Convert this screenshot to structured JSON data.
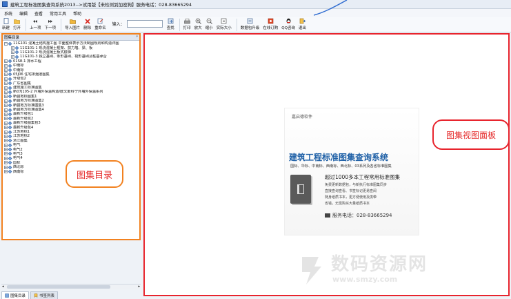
{
  "window": {
    "title": "建筑工程标准图集查询系统2013-->试用版【未检测到加密狗】服务电话：028-83665294"
  },
  "menu": [
    "系统",
    "编辑",
    "查看",
    "常用工具",
    "帮助"
  ],
  "toolbar": {
    "new": "新建",
    "open": "打开",
    "prev": "上一项",
    "next": "下一项",
    "import": "导入图片",
    "delete": "删除",
    "rename": "重命名",
    "input_label": "输入：",
    "input_value": "",
    "find": "查找",
    "print": "打印",
    "zoom_in": "放大",
    "zoom_out": "缩小",
    "actual": "实际大小",
    "update": "数据包升级",
    "order": "在线订购",
    "qq": "QQ咨询",
    "exit": "退出"
  },
  "tree": {
    "header": "图集目录",
    "pin": "ᵖ",
    "nodes": [
      {
        "label": "11G101 混凝土结构施工图 平面整体表示方法制图规则和构造详图",
        "level": 0,
        "exp": "−"
      },
      {
        "label": "11G101-1 现浇混凝土框架、剪力墙、梁、板",
        "level": 1,
        "exp": "+"
      },
      {
        "label": "11G101-2 现浇混凝土板式楼梯",
        "level": 1,
        "exp": "+"
      },
      {
        "label": "11G101-3 独立基础、条形基础、筏形基础及桩基承台",
        "level": 1,
        "exp": "+"
      },
      {
        "label": "01S8-1 排水工程",
        "level": 0,
        "exp": "+"
      },
      {
        "label": "中南标",
        "level": 0,
        "exp": "+"
      },
      {
        "label": "中南标",
        "level": 0,
        "exp": "+"
      },
      {
        "label": "05J06 住宅排烟道图集",
        "level": 0,
        "exp": "+"
      },
      {
        "label": "升级包2",
        "level": 0,
        "exp": "+"
      },
      {
        "label": "广东省图集",
        "level": 0,
        "exp": "+"
      },
      {
        "label": "建筑施工标准图集",
        "level": 0,
        "exp": "+"
      },
      {
        "label": "新07J105-2 外墙外保温构造/欧文斯科宁外墙外保温系列",
        "level": 0,
        "exp": "+"
      },
      {
        "label": "新疆地标图集1",
        "level": 0,
        "exp": "+"
      },
      {
        "label": "新疆地方标准图集2",
        "level": 0,
        "exp": "+"
      },
      {
        "label": "新疆地方标准图集3",
        "level": 0,
        "exp": "+"
      },
      {
        "label": "新疆地方标准图集4",
        "level": 0,
        "exp": "+"
      },
      {
        "label": "最新升级包1",
        "level": 0,
        "exp": "+"
      },
      {
        "label": "最新升级包2",
        "level": 0,
        "exp": "+"
      },
      {
        "label": "最新升级图集包3",
        "level": 0,
        "exp": "+"
      },
      {
        "label": "最新升级包4",
        "level": 0,
        "exp": "+"
      },
      {
        "label": "江苏地标1",
        "level": 0,
        "exp": "+"
      },
      {
        "label": "江苏地标2",
        "level": 0,
        "exp": "+"
      },
      {
        "label": "浙江图集",
        "level": 0,
        "exp": "+"
      },
      {
        "label": "电气",
        "level": 0,
        "exp": "+"
      },
      {
        "label": "电气2",
        "level": 0,
        "exp": "+"
      },
      {
        "label": "电气3",
        "level": 0,
        "exp": "+"
      },
      {
        "label": "电气4",
        "level": 0,
        "exp": "+"
      },
      {
        "label": "国标",
        "level": 0,
        "exp": "+"
      },
      {
        "label": "西北标",
        "level": 0,
        "exp": "+"
      },
      {
        "label": "西南标",
        "level": 0,
        "exp": "+"
      }
    ]
  },
  "bottom_tabs": [
    "图集目录",
    "书签列表"
  ],
  "callouts": {
    "left": "图集目录",
    "right": "图集视图面板"
  },
  "splash": {
    "company": "嘉启德软件",
    "app_name": "建筑工程标准图集查询系统",
    "std_line": "国标、华标、中南标、西南标、西北标、03系列及各省标准图集",
    "big": "超过1000多本工程常用标准图集",
    "features": [
      "免费更新数据包，与新执行标准图集同步",
      "直接查询查看、书签标记更易查阅",
      "随身纸质书本，更方便使用及携带",
      "省钱，无需购买大量纸质书本"
    ],
    "phone": "服务电话：028-83665294"
  },
  "watermark": {
    "main": "数码资源网",
    "url": "www.smzy.com"
  },
  "colors": {
    "orange": "#f2811f",
    "red": "#e8242d",
    "blue": "#1d5fa6"
  }
}
